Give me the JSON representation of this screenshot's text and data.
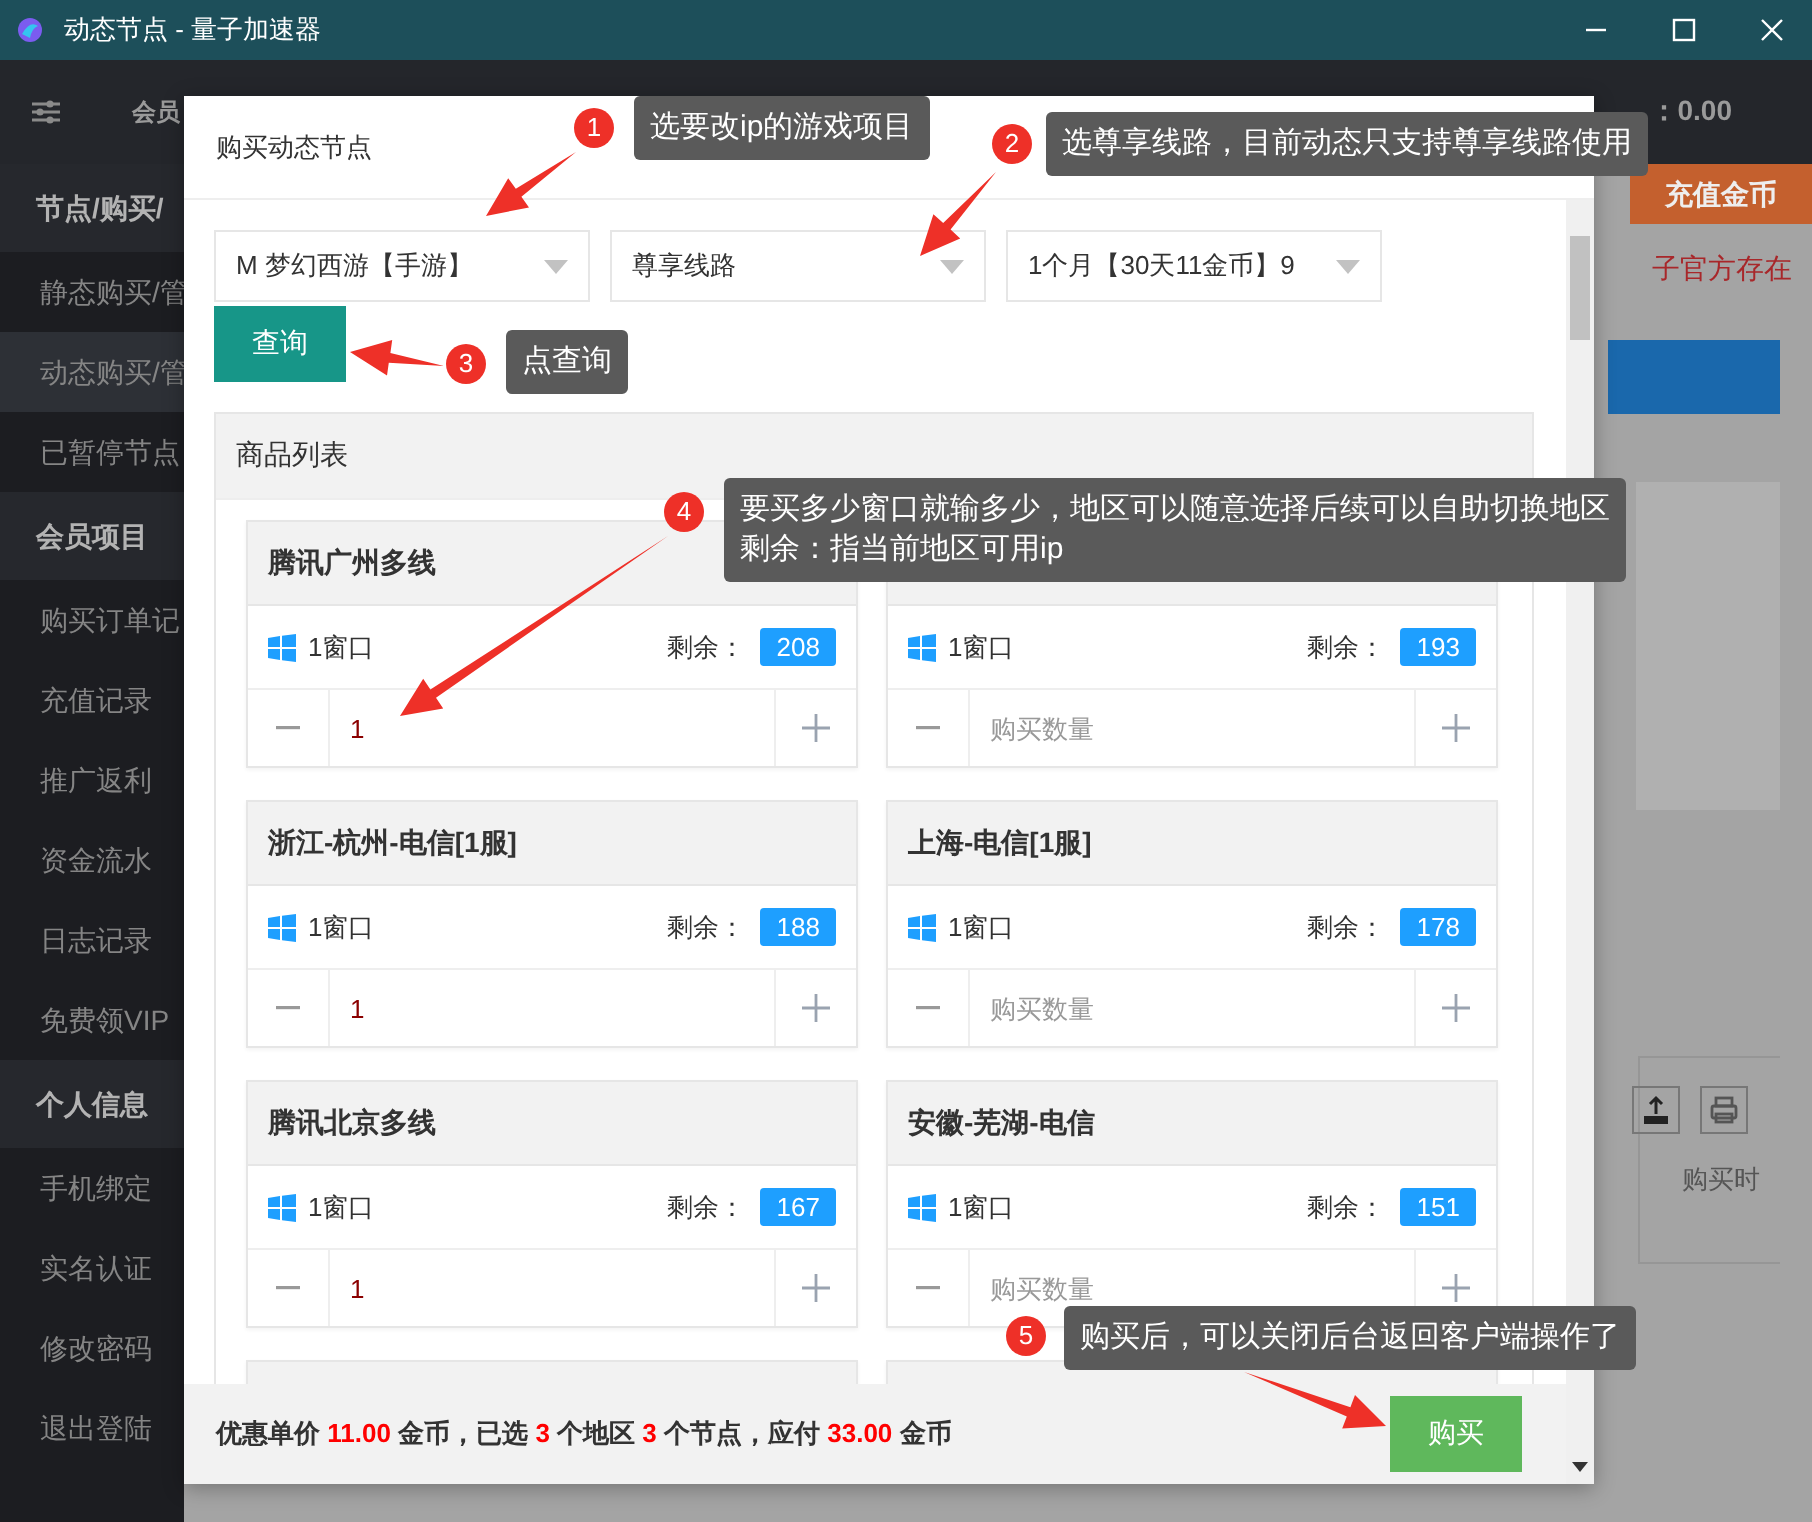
{
  "window": {
    "title": "动态节点 - 量子加速器"
  },
  "topbar": {
    "title": "会员",
    "balance": "：0.00"
  },
  "sidebar": {
    "groups": [
      {
        "label": "节点/购买/",
        "items": [
          {
            "label": "静态购买/管",
            "selected": false
          },
          {
            "label": "动态购买/管",
            "selected": true
          },
          {
            "label": "已暂停节点",
            "selected": false
          }
        ]
      },
      {
        "label": "会员项目",
        "items": [
          {
            "label": "购买订单记",
            "selected": false
          },
          {
            "label": "充值记录",
            "selected": false
          },
          {
            "label": "推广返利",
            "selected": false
          },
          {
            "label": "资金流水",
            "selected": false
          },
          {
            "label": "日志记录",
            "selected": false
          },
          {
            "label": "免费领VIP",
            "selected": false
          }
        ]
      },
      {
        "label": "个人信息",
        "items": [
          {
            "label": "手机绑定",
            "selected": false
          },
          {
            "label": "实名认证",
            "selected": false
          },
          {
            "label": "修改密码",
            "selected": false
          },
          {
            "label": "退出登陆",
            "selected": false
          }
        ]
      }
    ]
  },
  "background": {
    "recharge_button": "充值金币",
    "notice": "子官方存在",
    "column_header": "购买时"
  },
  "dialog": {
    "title": "购买动态节点",
    "selects": [
      "M 梦幻西游【手游】",
      "尊享线路",
      "1个月【30天11金币】9"
    ],
    "query_button": "查询",
    "list_title": "商品列表",
    "products": [
      {
        "title": "腾讯广州多线",
        "windows": "1窗口",
        "remaining_label": "剩余：",
        "remaining": "208",
        "quantity": "1"
      },
      {
        "windows": "1窗口",
        "remaining_label": "剩余：",
        "remaining": "193",
        "placeholder": "购买数量"
      },
      {
        "title": "浙江-杭州-电信[1服]",
        "windows": "1窗口",
        "remaining_label": "剩余：",
        "remaining": "188",
        "quantity": "1"
      },
      {
        "title": "上海-电信[1服]",
        "windows": "1窗口",
        "remaining_label": "剩余：",
        "remaining": "178",
        "placeholder": "购买数量"
      },
      {
        "title": "腾讯北京多线",
        "windows": "1窗口",
        "remaining_label": "剩余：",
        "remaining": "167",
        "quantity": "1"
      },
      {
        "title": "安徽-芜湖-电信",
        "windows": "1窗口",
        "remaining_label": "剩余：",
        "remaining": "151",
        "placeholder": "购买数量"
      }
    ],
    "summary": [
      {
        "kind": "text",
        "text": "优惠单价 "
      },
      {
        "kind": "number",
        "text": "11.00"
      },
      {
        "kind": "text",
        "text": " 金币，已选 "
      },
      {
        "kind": "number",
        "text": "3"
      },
      {
        "kind": "text",
        "text": " 个地区 "
      },
      {
        "kind": "number",
        "text": "3"
      },
      {
        "kind": "text",
        "text": " 个节点，应付 "
      },
      {
        "kind": "number",
        "text": "33.00"
      },
      {
        "kind": "text",
        "text": " 金币"
      }
    ],
    "buy_button": "购买"
  },
  "annotations": [
    {
      "number": "1",
      "lines": [
        "选要改ip的游戏项目"
      ]
    },
    {
      "number": "2",
      "lines": [
        "选尊享线路，目前动态只支持尊享线路使用"
      ]
    },
    {
      "number": "3",
      "lines": [
        "点查询"
      ]
    },
    {
      "number": "4",
      "lines": [
        "要买多少窗口就输多少，地区可以随意选择后续可以自助切换地区",
        "剩余：指当前地区可用ip"
      ]
    },
    {
      "number": "5",
      "lines": [
        "购买后，可以关闭后台返回客户端操作了"
      ]
    }
  ]
}
